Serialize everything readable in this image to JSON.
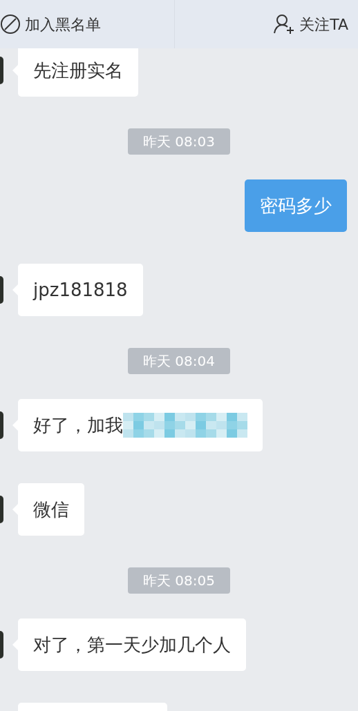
{
  "header": {
    "buttons": [
      {
        "kind": "block",
        "label": "加入黑名单"
      },
      {
        "kind": "follow",
        "label": "关注TA"
      }
    ]
  },
  "messages": [
    {
      "kind": "message",
      "outgoing": false,
      "text": "先注册实名"
    },
    {
      "kind": "time",
      "text": "昨天 08:03"
    },
    {
      "kind": "message",
      "outgoing": true,
      "text": "密码多少"
    },
    {
      "kind": "message",
      "outgoing": false,
      "text": "jpz181818"
    },
    {
      "kind": "time",
      "text": "昨天 08:04"
    },
    {
      "kind": "message",
      "outgoing": false,
      "text": "好了，加我",
      "redacted": true
    },
    {
      "kind": "message",
      "outgoing": false,
      "text": "微信"
    },
    {
      "kind": "time",
      "text": "昨天 08:05"
    },
    {
      "kind": "message",
      "outgoing": false,
      "text": "对了，第一天少加几个人"
    },
    {
      "kind": "partial"
    }
  ]
}
